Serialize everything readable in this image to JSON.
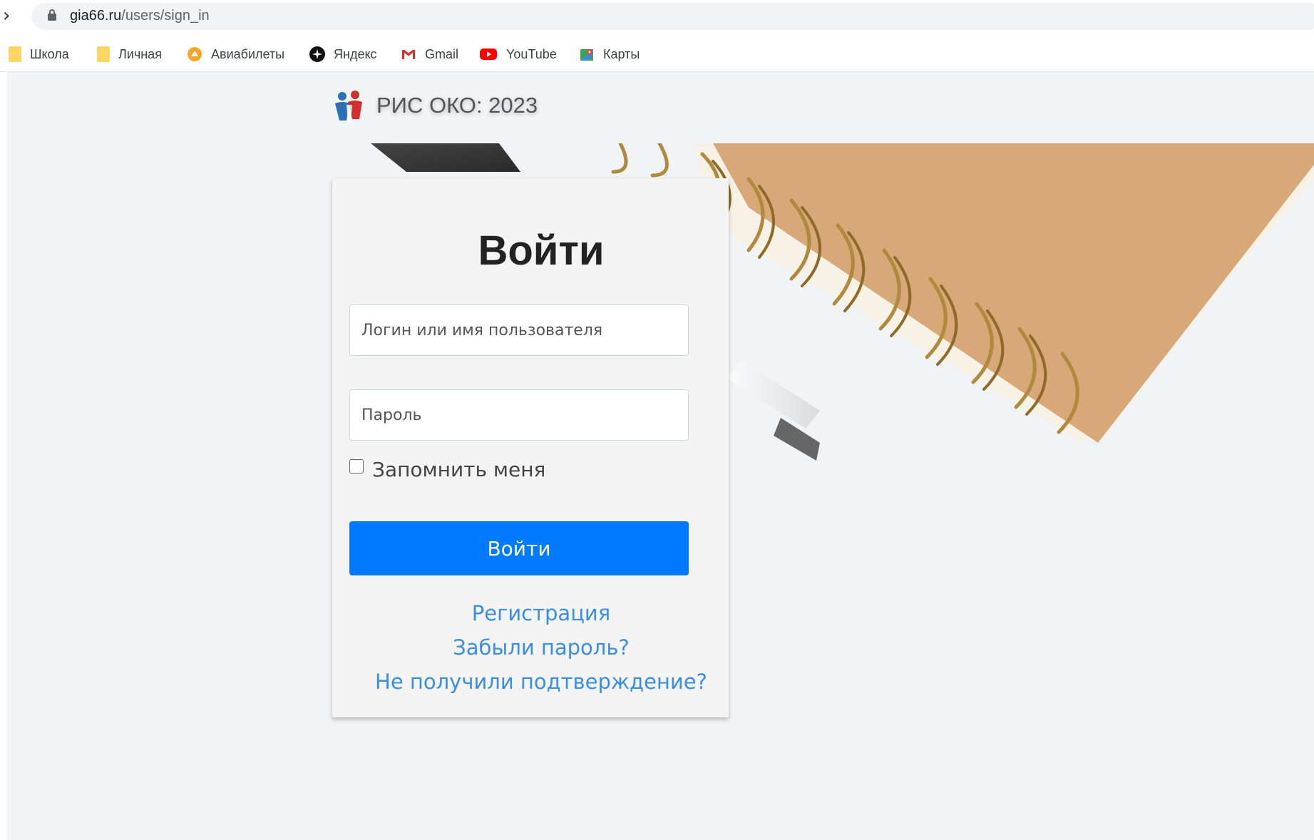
{
  "browser": {
    "url_domain": "gia66.ru",
    "url_path": "/users/sign_in"
  },
  "bookmarks": [
    {
      "label": "Школа",
      "icon": "folder-icon"
    },
    {
      "label": "Личная",
      "icon": "folder-icon"
    },
    {
      "label": "Авиабилеты",
      "icon": "plane-ticket-icon"
    },
    {
      "label": "Яндекс",
      "icon": "yandex-icon"
    },
    {
      "label": "Gmail",
      "icon": "gmail-icon"
    },
    {
      "label": "YouTube",
      "icon": "youtube-icon"
    },
    {
      "label": "Карты",
      "icon": "maps-icon"
    }
  ],
  "navbar": {
    "brand": "РИС ОКО: 2023"
  },
  "login": {
    "title": "Войти",
    "login_placeholder": "Логин или имя пользователя",
    "password_placeholder": "Пароль",
    "remember_label": "Запомнить меня",
    "submit_label": "Войти",
    "links": [
      "Регистрация",
      "Забыли пароль?",
      "Не получили подтверждение?"
    ]
  },
  "colors": {
    "primary": "#007bff",
    "link": "#3a8ee6",
    "notebook": "#d9a878",
    "spiral": "#b08a3c"
  }
}
